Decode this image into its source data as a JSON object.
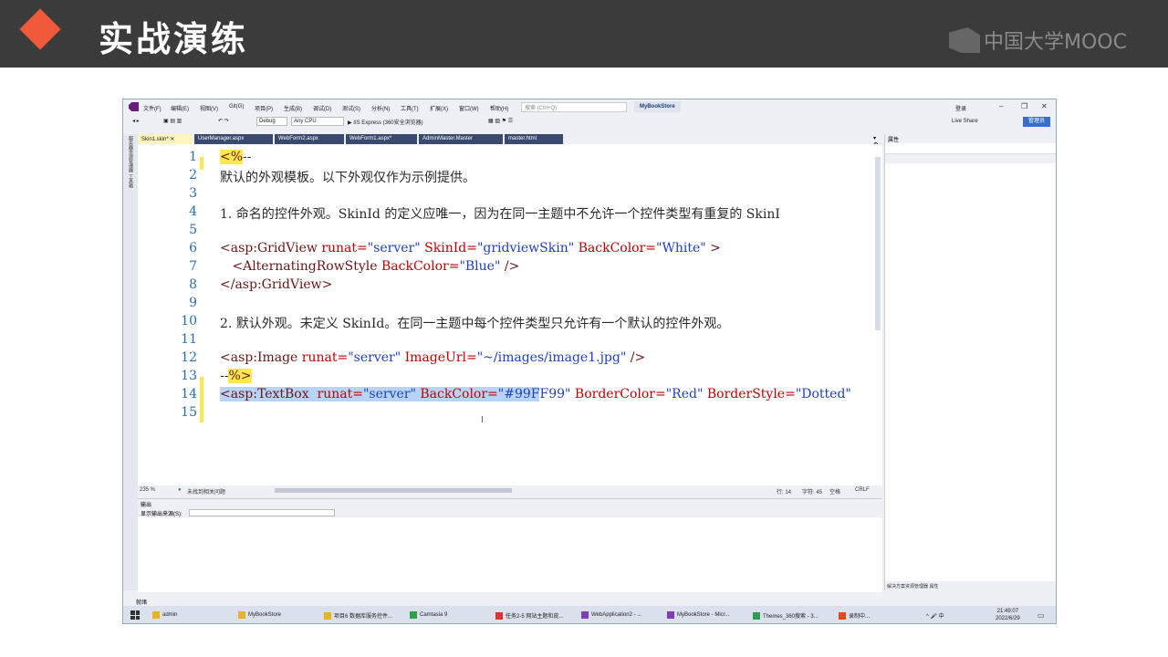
{
  "slide": {
    "title": "实战演练",
    "logo_text": "中国大学MOOC",
    "accent_color": "#f05a3a"
  },
  "vs": {
    "menu": [
      "文件(F)",
      "编辑(E)",
      "视图(V)",
      "Git(G)",
      "项目(P)",
      "生成(B)",
      "调试(D)",
      "测试(S)",
      "分析(N)",
      "工具(T)",
      "扩展(X)",
      "窗口(W)",
      "帮助(H)"
    ],
    "search_placeholder": "搜索 (Ctrl+Q)",
    "solution_name": "MyBookStore",
    "login_label": "登录",
    "toolbar": {
      "config": "Debug",
      "platform": "Any CPU",
      "run_label": "▶ IIS Express (360安全浏览器)",
      "live_share": "Live Share",
      "admin_badge": "管理员"
    },
    "tabs": [
      "Skin1.skin*",
      "UserManager.aspx",
      "WebForm2.aspx",
      "WebForm1.aspx*",
      "AdminMaster.Master",
      "master.html"
    ],
    "left_strip": [
      "服务器资源管理器",
      "工具箱"
    ],
    "code_lines": [
      {
        "num": "1",
        "segments": [
          {
            "t": "<%",
            "c": "t-yellow t-tag"
          },
          {
            "t": "--",
            "c": ""
          }
        ]
      },
      {
        "num": "2",
        "segments": [
          {
            "t": "默认的外观模板。以下外观仅作为示例提供。",
            "c": ""
          }
        ]
      },
      {
        "num": "3",
        "segments": []
      },
      {
        "num": "4",
        "segments": [
          {
            "t": "1. 命名的控件外观。SkinId 的定义应唯一，因为在同一主题中不允许一个控件类型有重复的 SkinI",
            "c": ""
          }
        ]
      },
      {
        "num": "5",
        "segments": []
      },
      {
        "num": "6",
        "segments": [
          {
            "t": "<asp:GridView ",
            "c": "t-tag"
          },
          {
            "t": "runat=",
            "c": "t-attr"
          },
          {
            "t": "\"server\" ",
            "c": "t-val"
          },
          {
            "t": "SkinId=",
            "c": "t-attr"
          },
          {
            "t": "\"gridviewSkin\" ",
            "c": "t-val"
          },
          {
            "t": "BackColor=",
            "c": "t-attr"
          },
          {
            "t": "\"White\" ",
            "c": "t-val"
          },
          {
            "t": ">",
            "c": "t-tag"
          }
        ]
      },
      {
        "num": "7",
        "segments": [
          {
            "t": "   <AlternatingRowStyle ",
            "c": "t-tag"
          },
          {
            "t": "BackColor=",
            "c": "t-attr"
          },
          {
            "t": "\"Blue\" ",
            "c": "t-val"
          },
          {
            "t": "/>",
            "c": "t-tag"
          }
        ]
      },
      {
        "num": "8",
        "segments": [
          {
            "t": "</asp:GridView>",
            "c": "t-tag"
          }
        ]
      },
      {
        "num": "9",
        "segments": []
      },
      {
        "num": "10",
        "segments": [
          {
            "t": "2. 默认外观。未定义 SkinId。在同一主题中每个控件类型只允许有一个默认的控件外观。",
            "c": ""
          }
        ]
      },
      {
        "num": "11",
        "segments": []
      },
      {
        "num": "12",
        "segments": [
          {
            "t": "<asp:Image ",
            "c": "t-tag"
          },
          {
            "t": "runat=",
            "c": "t-attr"
          },
          {
            "t": "\"server\" ",
            "c": "t-val"
          },
          {
            "t": "ImageUrl=",
            "c": "t-attr"
          },
          {
            "t": "\"~/images/image1.jpg\" ",
            "c": "t-val"
          },
          {
            "t": "/>",
            "c": "t-tag"
          }
        ]
      },
      {
        "num": "13",
        "segments": [
          {
            "t": "--",
            "c": ""
          },
          {
            "t": "%>",
            "c": "t-yellow t-tag"
          }
        ]
      },
      {
        "num": "14",
        "segments": [
          {
            "t": "<asp:TextBox  ",
            "c": "t-sel t-tag"
          },
          {
            "t": "runat=",
            "c": "t-sel t-attr"
          },
          {
            "t": "\"server\" ",
            "c": "t-sel t-val"
          },
          {
            "t": "BackColor=",
            "c": "t-sel t-attr"
          },
          {
            "t": "\"#99F",
            "c": "t-sel t-val"
          },
          {
            "t": "F99\" ",
            "c": "t-val"
          },
          {
            "t": "BorderColor=",
            "c": "t-attr"
          },
          {
            "t": "\"Red\" ",
            "c": "t-val"
          },
          {
            "t": "BorderStyle=",
            "c": "t-attr"
          },
          {
            "t": "\"Dotted\"",
            "c": "t-val"
          }
        ]
      },
      {
        "num": "15",
        "segments": []
      }
    ],
    "editor_status": {
      "zoom": "235 %",
      "issues": "未找到相关问题",
      "line": "行: 14",
      "char": "字符: 45",
      "mode": "空格",
      "eol": "CRLF"
    },
    "output": {
      "title": "输出",
      "source_label": "显示输出来源(S):"
    },
    "properties": {
      "title": "属性",
      "tabs": [
        "解决方案资源管理器",
        "属性"
      ]
    },
    "status_ready": "就绪"
  },
  "taskbar": {
    "items": [
      {
        "label": "admin",
        "icon": "folder-icon"
      },
      {
        "label": "MyBookStore",
        "icon": "folder-icon"
      },
      {
        "label": "项目6 数据库服务控件...",
        "icon": "folder-icon"
      },
      {
        "label": "Camtasia 9",
        "icon": "camtasia-icon"
      },
      {
        "label": "任务2-5 网站主题和皮...",
        "icon": "wps-icon"
      },
      {
        "label": "WebApplication2 - ...",
        "icon": "vs-icon"
      },
      {
        "label": "MyBookStore - Micr...",
        "icon": "vs-icon"
      },
      {
        "label": "Themes_360搜索 - 3...",
        "icon": "browser-icon"
      },
      {
        "label": "录制中...",
        "icon": "record-icon"
      }
    ],
    "tray": "^ 🎤 中",
    "time": "21:49:07",
    "date": "2022/6/29"
  }
}
